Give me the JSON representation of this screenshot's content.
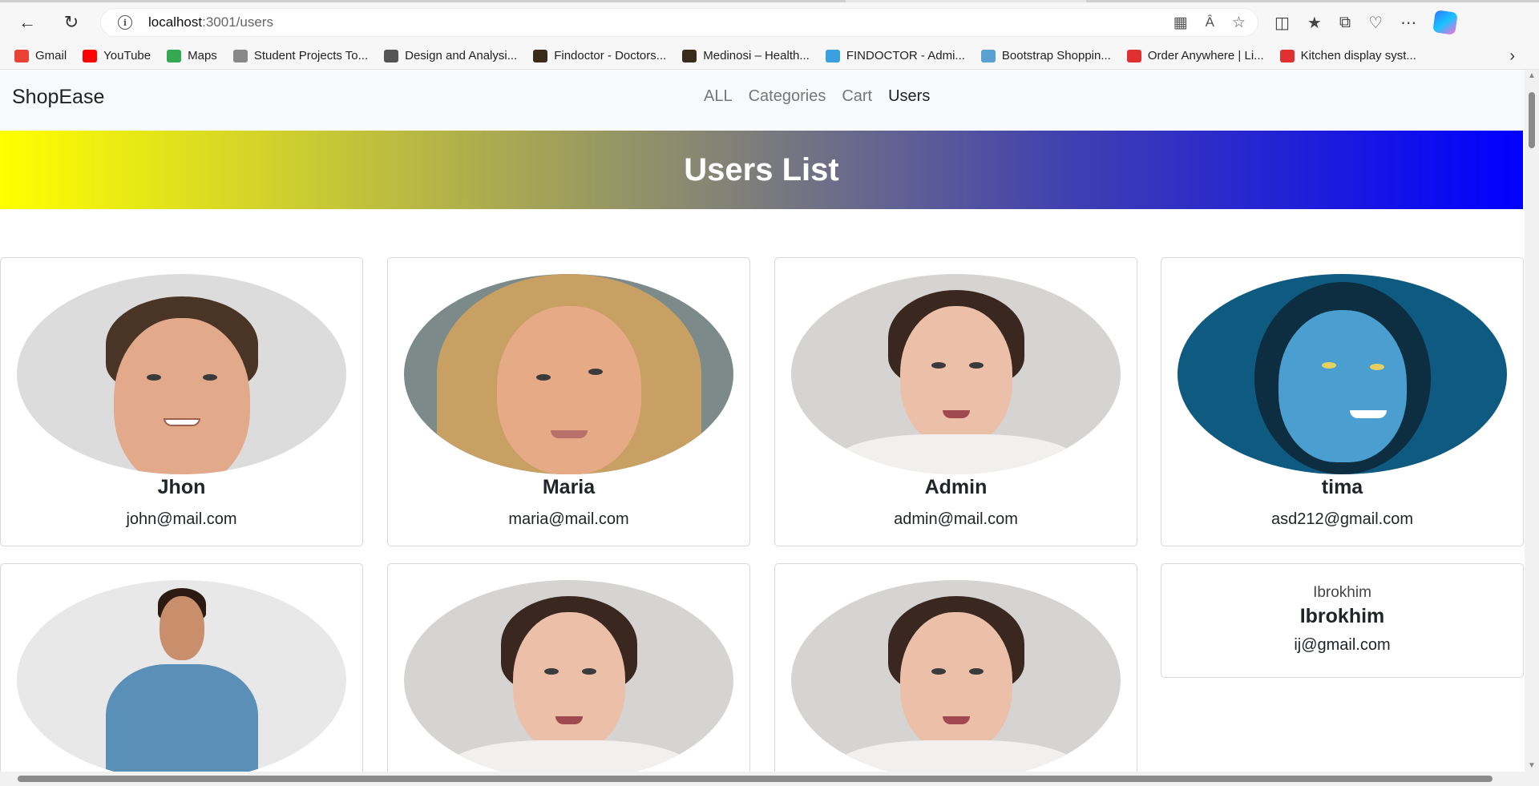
{
  "browser": {
    "url_host": "localhost",
    "url_path": ":3001/users",
    "bookmarks": [
      {
        "label": "Gmail",
        "color": "#ea4335"
      },
      {
        "label": "YouTube",
        "color": "#ff0000"
      },
      {
        "label": "Maps",
        "color": "#34a853"
      },
      {
        "label": "Student Projects To...",
        "color": "#888888"
      },
      {
        "label": "Design and Analysi...",
        "color": "#555555"
      },
      {
        "label": "Findoctor - Doctors...",
        "color": "#3a2a1a"
      },
      {
        "label": "Medinosi – Health...",
        "color": "#3a2a1a"
      },
      {
        "label": "FINDOCTOR - Admi...",
        "color": "#3aa0e0"
      },
      {
        "label": "Bootstrap Shoppin...",
        "color": "#5aa0d0"
      },
      {
        "label": "Order Anywhere | Li...",
        "color": "#e03030"
      },
      {
        "label": "Kitchen display syst...",
        "color": "#e03030"
      }
    ]
  },
  "navbar": {
    "brand": "ShopEase",
    "links": [
      "ALL",
      "Categories",
      "Cart",
      "Users"
    ],
    "active": "Users"
  },
  "banner": {
    "title": "Users List",
    "gradient": [
      "#ffff00",
      "#0000ff"
    ]
  },
  "users": [
    {
      "name": "Jhon",
      "email": "john@mail.com",
      "photo": "man-headshot"
    },
    {
      "name": "Maria",
      "email": "maria@mail.com",
      "photo": "blonde-woman"
    },
    {
      "name": "Admin",
      "email": "admin@mail.com",
      "photo": "brunette-woman"
    },
    {
      "name": "tima",
      "email": "asd212@gmail.com",
      "photo": "avatar-character"
    },
    {
      "name": "",
      "email": "",
      "photo": "man-blue-shirt"
    },
    {
      "name": "",
      "email": "",
      "photo": "brunette-woman"
    },
    {
      "name": "",
      "email": "",
      "photo": "brunette-woman"
    },
    {
      "name": "Ibrokhim",
      "email": "ij@gmail.com",
      "photo": "broken-image",
      "alt": "Ibrokhim"
    }
  ]
}
